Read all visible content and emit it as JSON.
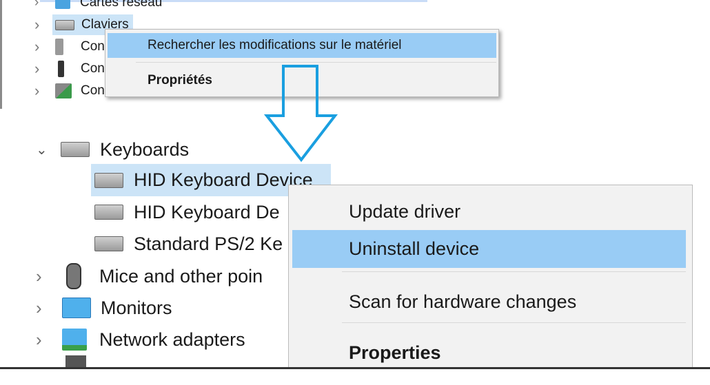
{
  "top_panel": {
    "items": [
      {
        "label": "Cartes réseau",
        "icon": "network-icon"
      },
      {
        "label": "Claviers",
        "icon": "keyboard-icon",
        "selected": true
      },
      {
        "label": "Con",
        "icon": "speaker-icon"
      },
      {
        "label": "Con",
        "icon": "usb-icon"
      },
      {
        "label": "Con",
        "icon": "controller-icon"
      }
    ],
    "context_menu": {
      "items": [
        {
          "label": "Rechercher les modifications sur le matériel",
          "highlighted": true
        },
        {
          "label": "Propriétés",
          "bold": true
        }
      ]
    }
  },
  "arrow": {
    "color": "#1a9fe0",
    "direction": "down"
  },
  "bottom_panel": {
    "category": {
      "label": "Keyboards",
      "expanded": true
    },
    "children": [
      {
        "label": "HID Keyboard Device",
        "selected": true
      },
      {
        "label": "HID Keyboard De"
      },
      {
        "label": "Standard PS/2 Ke"
      }
    ],
    "items": [
      {
        "label": "Mice and other poin",
        "icon": "mouse-icon"
      },
      {
        "label": "Monitors",
        "icon": "monitor-icon"
      },
      {
        "label": "Network adapters",
        "icon": "network-icon"
      }
    ],
    "context_menu": {
      "items": [
        {
          "label": "Update driver"
        },
        {
          "label": "Uninstall device",
          "highlighted": true
        },
        {
          "label": "Scan for hardware changes"
        },
        {
          "label": "Properties",
          "bold": true
        }
      ]
    }
  },
  "colors": {
    "highlight": "#99ccf5",
    "selection": "#cce4f7",
    "menu_bg": "#f2f2f2"
  }
}
